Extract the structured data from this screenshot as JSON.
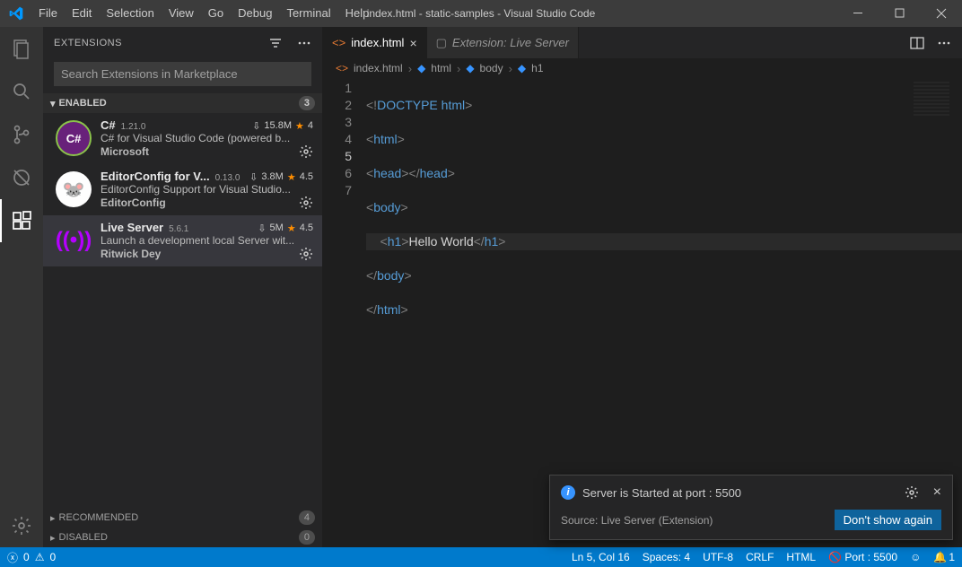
{
  "title": "index.html - static-samples - Visual Studio Code",
  "menu": [
    "File",
    "Edit",
    "Selection",
    "View",
    "Go",
    "Debug",
    "Terminal",
    "Help"
  ],
  "sidebar": {
    "title": "EXTENSIONS",
    "search_placeholder": "Search Extensions in Marketplace",
    "enabled": {
      "label": "ENABLED",
      "count": "3"
    },
    "recommended": {
      "label": "RECOMMENDED",
      "count": "4"
    },
    "disabled": {
      "label": "DISABLED",
      "count": "0"
    },
    "ext": [
      {
        "name": "C#",
        "ver": "1.21.0",
        "dl": "15.8M",
        "rating": "4",
        "desc": "C# for Visual Studio Code (powered b...",
        "author": "Microsoft"
      },
      {
        "name": "EditorConfig for V...",
        "ver": "0.13.0",
        "dl": "3.8M",
        "rating": "4.5",
        "desc": "EditorConfig Support for Visual Studio...",
        "author": "EditorConfig"
      },
      {
        "name": "Live Server",
        "ver": "5.6.1",
        "dl": "5M",
        "rating": "4.5",
        "desc": "Launch a development local Server wit...",
        "author": "Ritwick Dey"
      }
    ]
  },
  "tabs": {
    "t1": "index.html",
    "t2": "Extension: Live Server"
  },
  "breadcrumb": {
    "a": "index.html",
    "b": "html",
    "c": "body",
    "d": "h1"
  },
  "code": {
    "l1a": "<!",
    "l1b": "DOCTYPE",
    "l1c": " html",
    "l1d": ">",
    "l2a": "<",
    "l2b": "html",
    "l2c": ">",
    "l3a": "<",
    "l3b": "head",
    "l3c": "></",
    "l3d": "head",
    "l3e": ">",
    "l4a": "<",
    "l4b": "body",
    "l4c": ">",
    "l5a": "    <",
    "l5b": "h1",
    "l5c": ">",
    "l5d": "Hello World",
    "l5e": "</",
    "l5f": "h1",
    "l5g": ">",
    "l6a": "</",
    "l6b": "body",
    "l6c": ">",
    "l7a": "</",
    "l7b": "html",
    "l7c": ">"
  },
  "line_numbers": [
    "1",
    "2",
    "3",
    "4",
    "5",
    "6",
    "7"
  ],
  "toast": {
    "msg": "Server is Started at port : 5500",
    "src": "Source: Live Server (Extension)",
    "btn": "Don't show again"
  },
  "status": {
    "errors": "0",
    "warnings": "0",
    "ln": "Ln 5, Col 16",
    "spaces": "Spaces: 4",
    "enc": "UTF-8",
    "eol": "CRLF",
    "lang": "HTML",
    "port": "Port : 5500",
    "bell": "1"
  }
}
